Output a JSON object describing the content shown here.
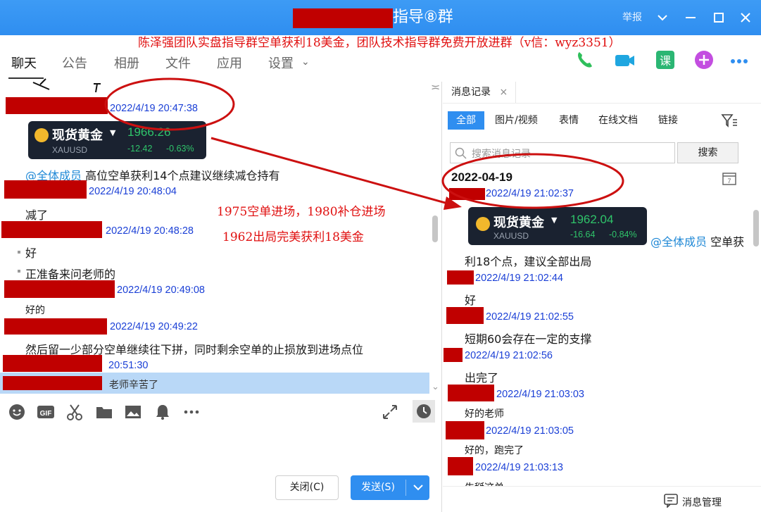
{
  "titlebar": {
    "title": "指导⑧群",
    "report": "举报",
    "dropdown_icon": "chevron-down-icon",
    "minimize_icon": "minimize-icon",
    "maximize_icon": "maximize-icon",
    "close_icon": "close-icon"
  },
  "banner": "陈泽强团队实盘指导群空单获利18美金，团队技术指导群免费开放进群（v信：wyz3351）",
  "tabs": [
    "聊天",
    "公告",
    "相册",
    "文件",
    "应用",
    "设置"
  ],
  "tab_icons": [
    "phone-icon",
    "video-icon",
    "course-icon",
    "add-icon",
    "more-icon"
  ],
  "left": {
    "close_mark": "≍",
    "messages": {
      "t1": "2022/4/19 20:47:38",
      "card": {
        "name": "现货黄金",
        "symbol": "XAUUSD",
        "price": "1966.26",
        "change": "-12.42",
        "change_pct": "-0.63%"
      },
      "m1_mention": "@全体成员",
      "m1_text": " 高位空单获利14个点建议继续减仓持有",
      "t2": "2022/4/19 20:48:04",
      "m2": "减了",
      "t3": "2022/4/19 20:48:28",
      "m3": "好",
      "m4": "正准备来问老师的",
      "t4": "2022/4/19 20:49:08",
      "m5": "好的",
      "t5": "2022/4/19 20:49:22",
      "m6": "然后留一少部分空单继续往下拼，同时剩余空单的止损放到进场点位",
      "t6": "20:51:30",
      "m7": "老师辛苦了"
    },
    "annotations": {
      "line1": "1975空单进场，1980补仓进场",
      "line2": "1962出局完美获利18美金"
    },
    "toolbar": [
      "emoji-icon",
      "gif-icon",
      "scissors-icon",
      "folder-icon",
      "image-icon",
      "bell-icon",
      "more-icon",
      "expand-icon",
      "history-icon"
    ],
    "close_button": "关闭(C)",
    "send_button": "发送(S)"
  },
  "right": {
    "tab": "消息记录",
    "filters": [
      "全部",
      "图片/视频",
      "表情",
      "在线文档",
      "链接"
    ],
    "search_placeholder": "搜索消息记录",
    "search_button": "搜索",
    "date_header": "2022-04-19",
    "t1": "2022/4/19 21:02:37",
    "card": {
      "name": "现货黄金",
      "symbol": "XAUUSD",
      "price": "1962.04",
      "change": "-16.64",
      "change_pct": "-0.84%"
    },
    "card_mention": "@全体成员",
    "card_text": " 空单获",
    "m1": "利18个点，建议全部出局",
    "t2": "2022/4/19 21:02:44",
    "m2": "好",
    "t3": "2022/4/19 21:02:55",
    "m3": "短期60会存在一定的支撑",
    "t4": "2022/4/19 21:02:56",
    "m4": "出完了",
    "t5": "2022/4/19 21:03:03",
    "m5": "好的老师",
    "t6": "2022/4/19 21:03:05",
    "m6": "好的，跑完了",
    "t7": "2022/4/19 21:03:13",
    "m7": "牛掰这单",
    "msg_mgmt": "消息管理"
  },
  "colors": {
    "titlebar": "#3d9bf5",
    "accent": "#2f8ef0",
    "redaction": "#c00000",
    "annotation": "#e01010",
    "timestamp": "#1a3fd6",
    "gain": "#2fc46a"
  }
}
